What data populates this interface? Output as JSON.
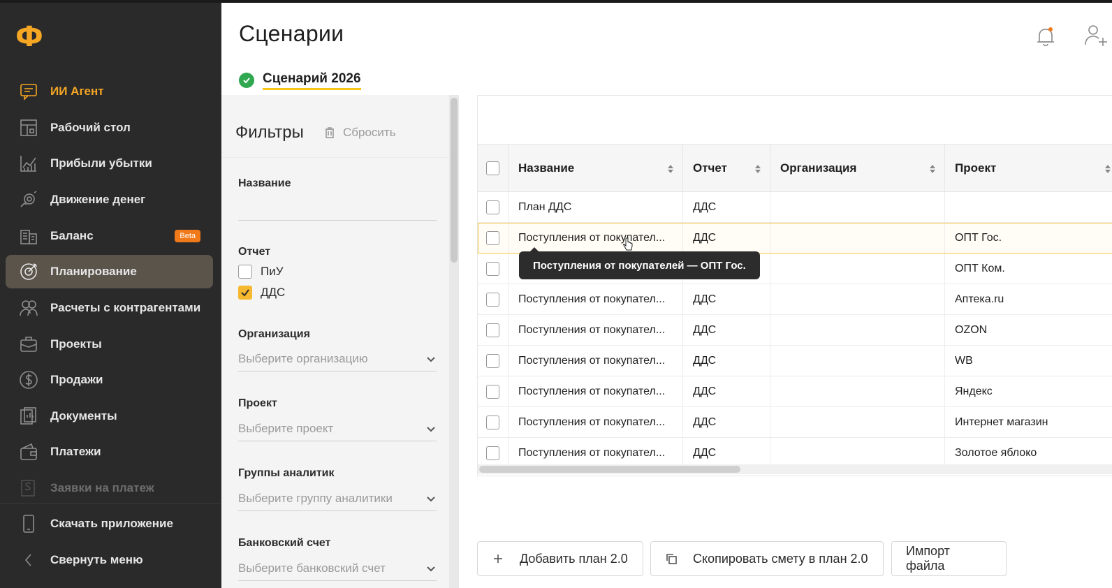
{
  "colors": {
    "sidebar_bg": "#2a2a2b",
    "accent": "#f5a623",
    "active_bg": "#5a544b",
    "beta": "#f07a1a",
    "success": "#2fa84f",
    "checkbox_checked": "#f5b82e"
  },
  "logo_glyph": "Ф",
  "sidebar": {
    "items": [
      {
        "label": "ИИ Агент",
        "icon": "chat-icon"
      },
      {
        "label": "Рабочий стол",
        "icon": "dashboard-icon"
      },
      {
        "label": "Прибыли убытки",
        "icon": "chart-icon"
      },
      {
        "label": "Движение денег",
        "icon": "money-flow-icon"
      },
      {
        "label": "Баланс",
        "icon": "balance-icon",
        "badge": "Beta"
      },
      {
        "label": "Планирование",
        "icon": "target-icon",
        "active": true
      },
      {
        "label": "Расчеты с контрагентами",
        "icon": "users-icon"
      },
      {
        "label": "Проекты",
        "icon": "briefcase-icon"
      },
      {
        "label": "Продажи",
        "icon": "dollar-icon"
      },
      {
        "label": "Документы",
        "icon": "document-icon"
      },
      {
        "label": "Платежи",
        "icon": "wallet-icon"
      },
      {
        "label": "Заявки на платеж",
        "icon": "request-icon"
      }
    ],
    "download_app": "Скачать приложение",
    "collapse": "Свернуть меню"
  },
  "header": {
    "title": "Сценарии",
    "tab": "Сценарий 2026"
  },
  "filters": {
    "title": "Фильтры",
    "reset": "Сбросить",
    "name_label": "Название",
    "report_label": "Отчет",
    "report_options": [
      {
        "label": "ПиУ",
        "checked": false
      },
      {
        "label": "ДДС",
        "checked": true
      }
    ],
    "org_label": "Организация",
    "org_placeholder": "Выберите организацию",
    "project_label": "Проект",
    "project_placeholder": "Выберите проект",
    "groups_label": "Группы аналитик",
    "groups_placeholder": "Выберите группу аналитики",
    "bank_label": "Банковский счет",
    "bank_placeholder": "Выберите банковский счет"
  },
  "table": {
    "columns": [
      "Название",
      "Отчет",
      "Организация",
      "Проект"
    ],
    "rows": [
      {
        "name": "План ДДС",
        "report": "ДДС",
        "org": "",
        "project": ""
      },
      {
        "name": "Поступления от покупател...",
        "report": "ДДС",
        "org": "",
        "project": "ОПТ Гос."
      },
      {
        "name": "",
        "report": "",
        "org": "",
        "project": "ОПТ Ком."
      },
      {
        "name": "Поступления от покупател...",
        "report": "ДДС",
        "org": "",
        "project": "Аптека.ru"
      },
      {
        "name": "Поступления от покупател...",
        "report": "ДДС",
        "org": "",
        "project": "OZON"
      },
      {
        "name": "Поступления от покупател...",
        "report": "ДДС",
        "org": "",
        "project": "WB"
      },
      {
        "name": "Поступления от покупател...",
        "report": "ДДС",
        "org": "",
        "project": "Яндекс"
      },
      {
        "name": "Поступления от покупател...",
        "report": "ДДС",
        "org": "",
        "project": "Интернет магазин"
      },
      {
        "name": "Поступления от покупател...",
        "report": "ДДС",
        "org": "",
        "project": "Золотое яблоко"
      }
    ],
    "tooltip": "Поступления от покупателей — ОПТ Гос."
  },
  "buttons": {
    "add_plan": "Добавить план 2.0",
    "copy_estimate": "Скопировать смету в план 2.0",
    "import_file": "Импорт файла"
  }
}
